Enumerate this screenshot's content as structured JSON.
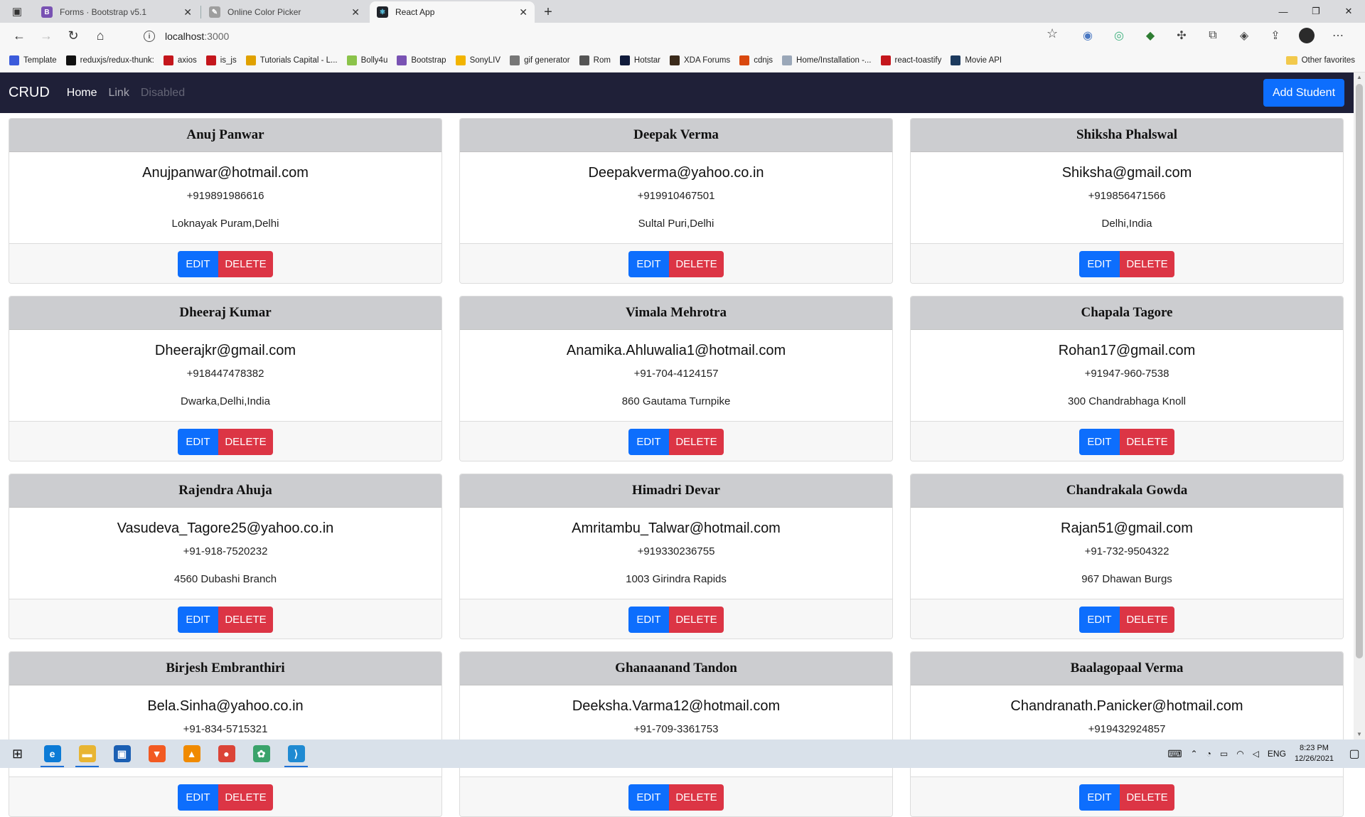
{
  "browser": {
    "tabs": [
      {
        "title": "Forms · Bootstrap v5.1",
        "favicon": "bootstrap-icon",
        "favicon_color": "#7952b3",
        "active": false
      },
      {
        "title": "Online Color Picker",
        "favicon": "picker-icon",
        "favicon_color": "#9e9e9e",
        "active": false
      },
      {
        "title": "React App",
        "favicon": "react-icon",
        "favicon_color": "#20232a",
        "active": true
      }
    ],
    "url_host": "localhost",
    "url_port": ":3000",
    "bookmarks": [
      {
        "label": "Template",
        "icon": "bookmark-icon",
        "color": "#3b5bdb"
      },
      {
        "label": "reduxjs/redux-thunk:",
        "icon": "github-icon",
        "color": "#111111"
      },
      {
        "label": "axios",
        "icon": "red-square-icon",
        "color": "#c4161c"
      },
      {
        "label": "is_js",
        "icon": "red-square-icon",
        "color": "#c4161c"
      },
      {
        "label": "Tutorials Capital - L...",
        "icon": "puzzle-icon",
        "color": "#e0a100"
      },
      {
        "label": "Bolly4u",
        "icon": "w-icon",
        "color": "#8bc34a"
      },
      {
        "label": "Bootstrap",
        "icon": "bootstrap-icon",
        "color": "#7952b3"
      },
      {
        "label": "SonyLIV",
        "icon": "check-icon",
        "color": "#f2b400"
      },
      {
        "label": "gif generator",
        "icon": "document-icon",
        "color": "#777777"
      },
      {
        "label": "Rom",
        "icon": "gear-icon",
        "color": "#555555"
      },
      {
        "label": "Hotstar",
        "icon": "hotstar-icon",
        "color": "#0f1a3a"
      },
      {
        "label": "XDA Forums",
        "icon": "xda-icon",
        "color": "#3a2a1a"
      },
      {
        "label": "cdnjs",
        "icon": "code-icon",
        "color": "#d9480f"
      },
      {
        "label": "Home/Installation -...",
        "icon": "gear-icon",
        "color": "#9aa7b8"
      },
      {
        "label": "react-toastify",
        "icon": "red-square-icon",
        "color": "#c4161c"
      },
      {
        "label": "Movie API",
        "icon": "api-icon",
        "color": "#1c3a5e"
      }
    ],
    "other_favorites": "Other favorites"
  },
  "navbar": {
    "brand": "CRUD",
    "links": [
      {
        "label": "Home",
        "state": "active"
      },
      {
        "label": "Link",
        "state": "normal"
      },
      {
        "label": "Disabled",
        "state": "disabled"
      }
    ],
    "add_button": "Add Student"
  },
  "buttons": {
    "edit": "EDIT",
    "delete": "DELETE"
  },
  "students": [
    {
      "name": "Anuj Panwar",
      "email": "Anujpanwar@hotmail.com",
      "phone": "+919891986616",
      "address": "Loknayak Puram,Delhi"
    },
    {
      "name": "Deepak Verma",
      "email": "Deepakverma@yahoo.co.in",
      "phone": "+919910467501",
      "address": "Sultal Puri,Delhi"
    },
    {
      "name": "Shiksha Phalswal",
      "email": "Shiksha@gmail.com",
      "phone": "+919856471566",
      "address": "Delhi,India"
    },
    {
      "name": "Dheeraj Kumar",
      "email": "Dheerajkr@gmail.com",
      "phone": "+918447478382",
      "address": "Dwarka,Delhi,India"
    },
    {
      "name": "Vimala Mehrotra",
      "email": "Anamika.Ahluwalia1@hotmail.com",
      "phone": "+91-704-4124157",
      "address": "860 Gautama Turnpike"
    },
    {
      "name": "Chapala Tagore",
      "email": "Rohan17@gmail.com",
      "phone": "+91947-960-7538",
      "address": "300 Chandrabhaga Knoll"
    },
    {
      "name": "Rajendra Ahuja",
      "email": "Vasudeva_Tagore25@yahoo.co.in",
      "phone": "+91-918-7520232",
      "address": "4560 Dubashi Branch"
    },
    {
      "name": "Himadri Devar",
      "email": "Amritambu_Talwar@hotmail.com",
      "phone": "+919330236755",
      "address": "1003 Girindra Rapids"
    },
    {
      "name": "Chandrakala Gowda",
      "email": "Rajan51@gmail.com",
      "phone": "+91-732-9504322",
      "address": "967 Dhawan Burgs"
    },
    {
      "name": "Birjesh Embranthiri",
      "email": "Bela.Sinha@yahoo.co.in",
      "phone": "+91-834-5715321",
      "address": ""
    },
    {
      "name": "Ghanaanand Tandon",
      "email": "Deeksha.Varma12@hotmail.com",
      "phone": "+91-709-3361753",
      "address": ""
    },
    {
      "name": "Baalagopaal Verma",
      "email": "Chandranath.Panicker@hotmail.com",
      "phone": "+919432924857",
      "address": ""
    }
  ],
  "taskbar": {
    "apps": [
      {
        "name": "edge-icon",
        "color": "#0c7bd6",
        "open": true
      },
      {
        "name": "file-explorer-icon",
        "color": "#e8b533",
        "open": true
      },
      {
        "name": "store-icon",
        "color": "#1b5fb3",
        "open": false
      },
      {
        "name": "brave-icon",
        "color": "#f25a22",
        "open": false
      },
      {
        "name": "vlc-icon",
        "color": "#f08a00",
        "open": false
      },
      {
        "name": "chrome-icon",
        "color": "#db4437",
        "open": false
      },
      {
        "name": "app-icon",
        "color": "#3aa36b",
        "open": false
      },
      {
        "name": "vscode-icon",
        "color": "#1f8ad2",
        "open": true
      }
    ],
    "language": "ENG",
    "time": "8:23 PM",
    "date": "12/26/2021"
  }
}
